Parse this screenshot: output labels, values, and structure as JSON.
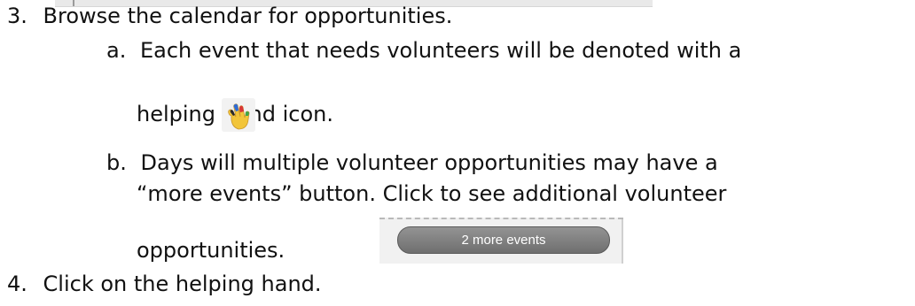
{
  "steps": [
    {
      "num": "3.",
      "text": "Browse the calendar for opportunities."
    },
    {
      "num": "4.",
      "text": "Click on the helping hand."
    }
  ],
  "substeps": {
    "a": {
      "letter": "a.",
      "line1": "Each event that needs volunteers will be denoted with a",
      "line2": "helping hand icon."
    },
    "b": {
      "letter": "b.",
      "line1": "Days will multiple volunteer opportunities may have a",
      "line2": "“more events” button.  Click to see additional volunteer",
      "line3": "opportunities."
    }
  },
  "more_events_button": {
    "label": "2 more events"
  },
  "icons": {
    "hand": "helping-hand-icon"
  }
}
